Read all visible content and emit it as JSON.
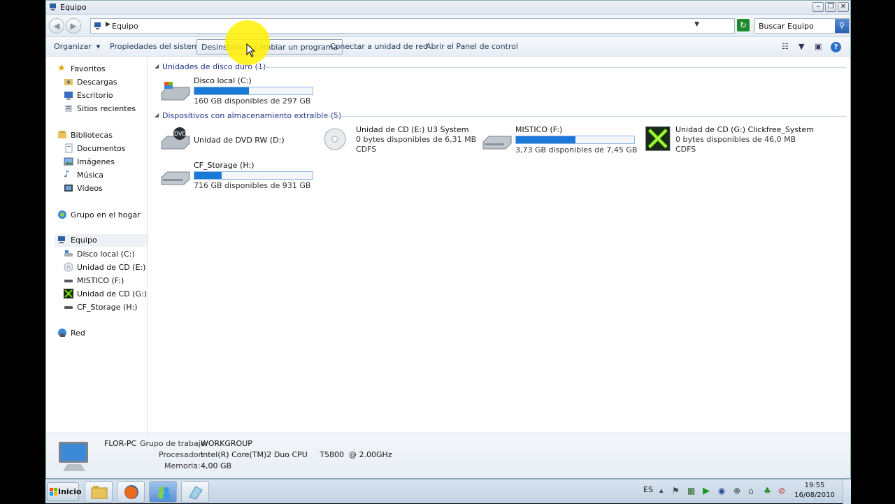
{
  "window": {
    "title": "Equipo",
    "address_crumb": "Equipo",
    "search_placeholder": "Buscar Equipo"
  },
  "toolbar": {
    "organize": "Organizar",
    "organize_arrow": "▾",
    "system_properties": "Propiedades del sistema",
    "uninstall": "Desinstalar o cambiar un programa",
    "map_drive": "Conectar a unidad de red",
    "control_panel": "Abrir el Panel de control"
  },
  "sidebar": {
    "favorites": {
      "label": "Favoritos",
      "items": [
        {
          "label": "Descargas",
          "icon": "downloads-folder-icon"
        },
        {
          "label": "Escritorio",
          "icon": "desktop-folder-icon"
        },
        {
          "label": "Sitios recientes",
          "icon": "recent-places-icon"
        }
      ]
    },
    "libraries": {
      "label": "Bibliotecas",
      "items": [
        {
          "label": "Documentos",
          "icon": "documents-icon"
        },
        {
          "label": "Imágenes",
          "icon": "pictures-icon"
        },
        {
          "label": "Música",
          "icon": "music-icon"
        },
        {
          "label": "Vídeos",
          "icon": "videos-icon"
        }
      ]
    },
    "homegroup": {
      "label": "Grupo en el hogar"
    },
    "computer": {
      "label": "Equipo",
      "items": [
        {
          "label": "Disco local (C:)",
          "icon": "hard-disk-icon"
        },
        {
          "label": "Unidad de CD (E:) U3 System",
          "icon": "cd-icon"
        },
        {
          "label": "MISTICO (F:)",
          "icon": "usb-drive-icon"
        },
        {
          "label": "Unidad de CD (G:) Clickfree_System",
          "icon": "clickfree-icon"
        },
        {
          "label": "CF_Storage (H:)",
          "icon": "usb-drive-icon"
        }
      ]
    },
    "network": {
      "label": "Red"
    }
  },
  "groups": {
    "hard_disks": "Unidades de disco duro (1)",
    "removable": "Dispositivos con almacenamiento extraíble (5)"
  },
  "drives": {
    "c": {
      "name": "Disco local (C:)",
      "space": "160 GB disponibles de 297 GB",
      "used_fraction": 0.46
    },
    "d": {
      "name": "Unidad de DVD RW (D:)"
    },
    "e": {
      "name": "Unidad de CD (E:) U3 System",
      "space": "0 bytes disponibles de 6,31 MB",
      "fs": "CDFS"
    },
    "f": {
      "name": "MISTICO (F:)",
      "space": "3,73 GB disponibles de 7,45 GB",
      "used_fraction": 0.5
    },
    "g": {
      "name": "Unidad de CD (G:) Clickfree_System",
      "space": "0 bytes disponibles de 46,0 MB",
      "fs": "CDFS"
    },
    "h": {
      "name": "CF_Storage (H:)",
      "space": "716 GB disponibles de 931 GB",
      "used_fraction": 0.23
    }
  },
  "details": {
    "name": "FLOR-PC",
    "workgroup_label": "Grupo de trabajo:",
    "workgroup": "WORKGROUP",
    "cpu_label": "Procesador:",
    "cpu": "Intel(R) Core(TM)2 Duo CPU     T5800  @ 2.00GHz",
    "memory_label": "Memoria:",
    "memory": "4,00 GB"
  },
  "taskbar": {
    "start_label": "Inicio",
    "language": "ES",
    "time": "19:55",
    "date": "16/08/2010"
  },
  "colors": {
    "bar_fill": "#1a78d8",
    "group_text": "#1e3287",
    "toolbar_text": "#1e395b"
  }
}
